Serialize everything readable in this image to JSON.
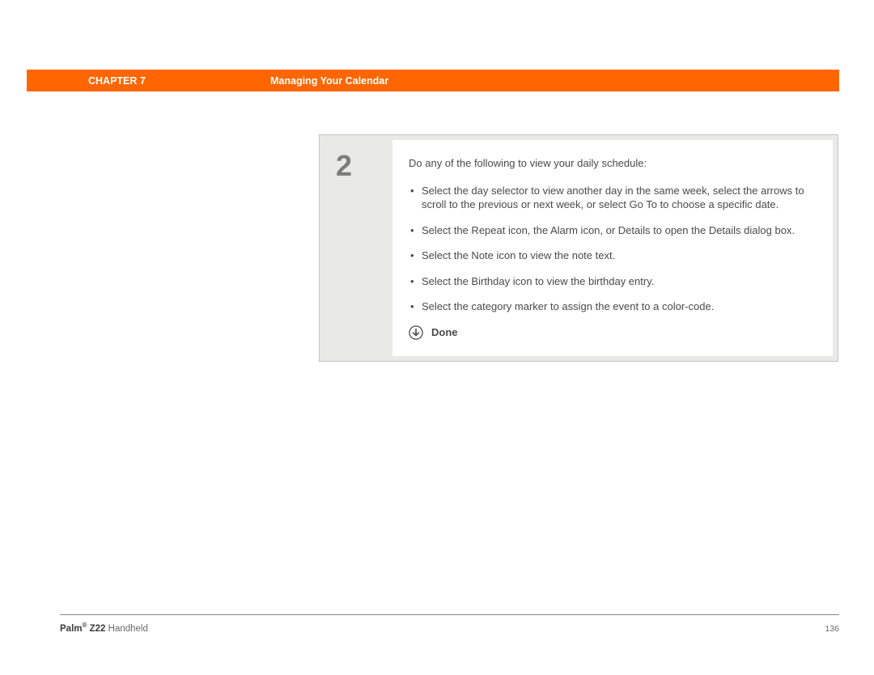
{
  "header": {
    "chapter_label": "CHAPTER 7",
    "title": "Managing Your Calendar"
  },
  "step": {
    "number": "2",
    "intro": "Do any of the following to view your daily schedule:",
    "bullets": [
      "Select the day selector to view another day in the same week, select the arrows to scroll to the previous or next week, or select Go To to choose a specific date.",
      "Select the Repeat icon, the Alarm icon, or Details to open the Details dialog box.",
      "Select the Note icon to view the note text.",
      "Select the Birthday icon to view the birthday entry.",
      "Select the category marker to assign the event to a color-code."
    ],
    "done_label": "Done"
  },
  "footer": {
    "product_bold": "Palm® Z22",
    "product_rest": " Handheld",
    "page_number": "136"
  }
}
